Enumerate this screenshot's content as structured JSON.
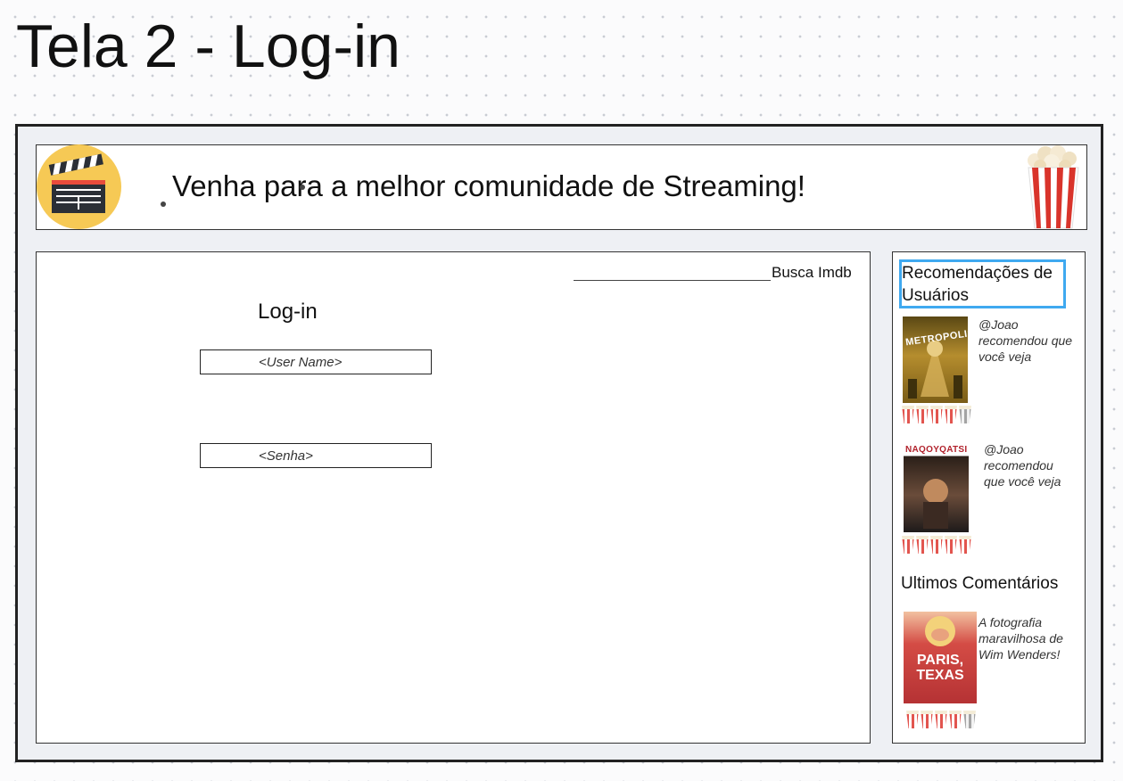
{
  "page": {
    "title": "Tela 2 - Log-in"
  },
  "header": {
    "tagline": "Venha para a melhor comunidade de Streaming!"
  },
  "search": {
    "label": "Busca Imdb"
  },
  "login": {
    "heading": "Log-in",
    "username_placeholder": "<User Name>",
    "password_placeholder": "<Senha>"
  },
  "sidebar": {
    "recommendations_title": "Recomendações de Usuários",
    "recommendations": [
      {
        "poster_text": "METROPOLIS",
        "note": "@Joao recomendou que você veja",
        "rating": 4,
        "rating_max": 5
      },
      {
        "poster_text": "NAQOYQATSI",
        "note": "@Joao recomendou que você veja",
        "rating": 5,
        "rating_max": 5
      }
    ],
    "comments_title": "Ultimos Comentários",
    "comments": [
      {
        "poster_text": "PARIS, TEXAS",
        "note": "A fotografia maravilhosa de Wim Wenders!",
        "rating": 4,
        "rating_max": 5
      }
    ]
  },
  "colors": {
    "accent": "#3fa9f0",
    "logo_bg": "#f6c955",
    "frame_bg": "#eef0f4"
  },
  "icons": {
    "logo": "clapperboard-icon",
    "popcorn": "popcorn-icon",
    "rating": "popcorn-bucket-icon"
  }
}
